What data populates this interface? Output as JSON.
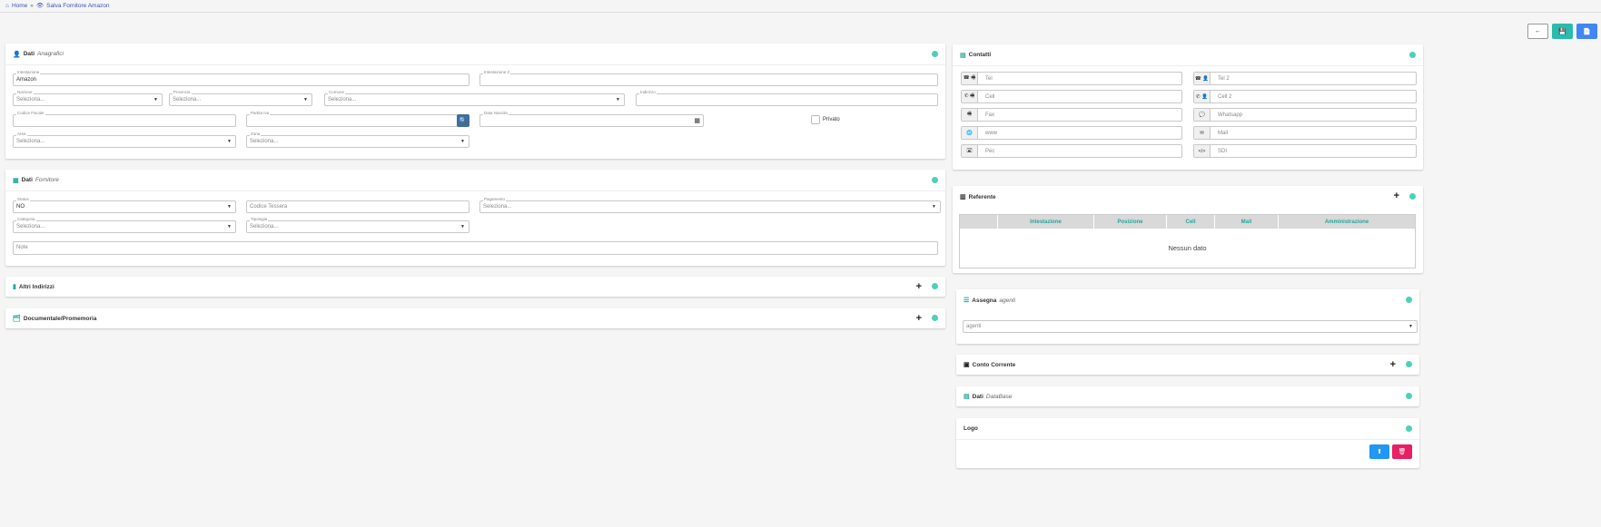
{
  "breadcrumb": {
    "home": "Home",
    "sep": "»",
    "current": "Salva Fornitore Amazon"
  },
  "toolbar": {
    "back": "←",
    "save": "💾",
    "doc": "📄"
  },
  "anagrafici": {
    "title": "Dati",
    "subtitle": "Anagrafici",
    "intestazione": {
      "label": "Intestazione",
      "value": "Amazon"
    },
    "intestazione2": {
      "label": "Intestazione 2"
    },
    "nazione": {
      "label": "Nazione",
      "placeholder": "Seleziona..."
    },
    "provincia": {
      "label": "Provincia",
      "placeholder": "Seleziona..."
    },
    "comune": {
      "label": "Comune",
      "placeholder": "Seleziona..."
    },
    "indirizzo": {
      "label": "Indirizzo"
    },
    "codice_fiscale": {
      "label": "Codice Fiscale"
    },
    "partita_iva": {
      "label": "Partita Iva"
    },
    "data_nascita": {
      "label": "Data Nascita"
    },
    "privato": "Privato",
    "area": {
      "label": "Area",
      "placeholder": "Seleziona..."
    },
    "zona": {
      "label": "Zona",
      "placeholder": "Seleziona..."
    }
  },
  "fornitore": {
    "title": "Dati",
    "subtitle": "Fornitore",
    "status": {
      "label": "Status",
      "value": "NO"
    },
    "codice_tessera": {
      "placeholder": "Codice Tessera"
    },
    "pagamento": {
      "label": "Pagamento",
      "placeholder": "Seleziona..."
    },
    "categoria": {
      "label": "Categoria",
      "placeholder": "Seleziona..."
    },
    "tipologia": {
      "label": "Tipologia",
      "placeholder": "Seleziona..."
    },
    "note": {
      "placeholder": "Note"
    }
  },
  "altri_indirizzi": {
    "title": "Altri Indirizzi"
  },
  "documentale": {
    "title": "Documentale/Promemoria"
  },
  "contatti": {
    "title": "Contatti",
    "fields": [
      {
        "icon": "☎ 🖷",
        "placeholder": "Tel"
      },
      {
        "icon": "☎ 👤",
        "placeholder": "Tel 2"
      },
      {
        "icon": "✆ 🖷",
        "placeholder": "Cell"
      },
      {
        "icon": "✆ 👤",
        "placeholder": "Cell 2"
      },
      {
        "icon": "🖷",
        "placeholder": "Fax"
      },
      {
        "icon": "💬",
        "placeholder": "Whatsapp"
      },
      {
        "icon": "🌐",
        "placeholder": "www"
      },
      {
        "icon": "✉",
        "placeholder": "Mail"
      },
      {
        "icon": "🖃",
        "placeholder": "Pec"
      },
      {
        "icon": "</>",
        "placeholder": "SDI"
      }
    ]
  },
  "referente": {
    "title": "Referente",
    "columns": [
      "Intestazione",
      "Posizione",
      "Cell",
      "Mail",
      "Amministrazione"
    ],
    "empty": "Nessun dato"
  },
  "assegna": {
    "title": "Assegna",
    "subtitle": "agenti",
    "select_placeholder": "agenti"
  },
  "conto_corrente": {
    "title": "Conto Corrente"
  },
  "database": {
    "title": "Dati",
    "subtitle": "DataBase"
  },
  "logo": {
    "title": "Logo",
    "upload": "⬆",
    "delete": "🗑"
  },
  "icons": {
    "plus": "+",
    "caret": "▼",
    "search": "🔍",
    "calendar": "▦"
  },
  "colors": {
    "accent": "#26a69a",
    "dot": "#4dd0b9",
    "save": "#2bbbad",
    "doc": "#4285f4",
    "upload": "#2196f3",
    "delete": "#e91e63",
    "search": "#3f6d9e"
  }
}
